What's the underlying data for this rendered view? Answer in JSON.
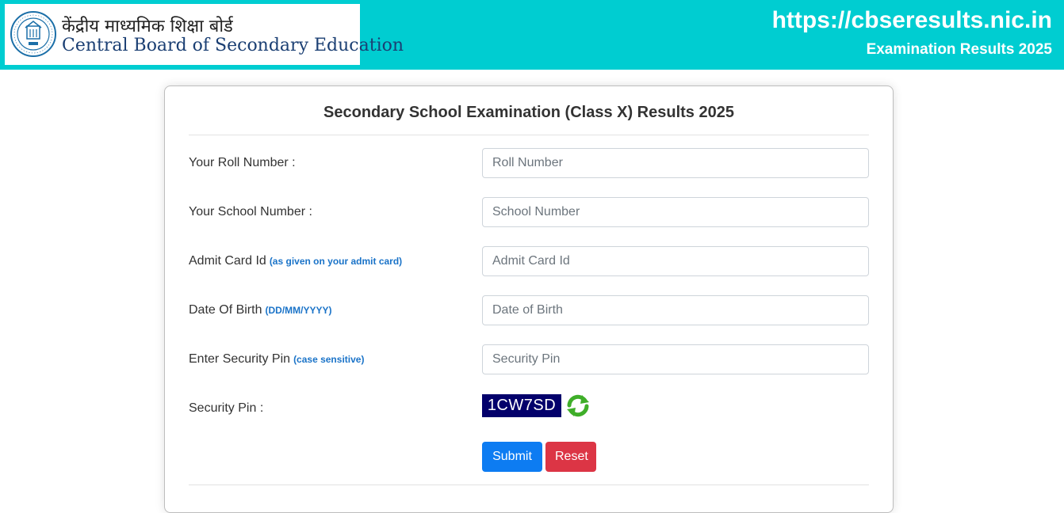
{
  "header": {
    "logo_hindi": "केंद्रीय माध्यमिक शिक्षा बोर्ड",
    "logo_english": "Central Board of Secondary Education",
    "site_url": "https://cbseresults.nic.in",
    "site_subtitle": "Examination Results 2025",
    "bg_color": "#00cdd1"
  },
  "form": {
    "title": "Secondary School Examination (Class X) Results 2025",
    "fields": [
      {
        "label": "Your Roll Number :",
        "note": "",
        "placeholder": "Roll Number",
        "value": ""
      },
      {
        "label": "Your School Number :",
        "note": "",
        "placeholder": "School Number",
        "value": ""
      },
      {
        "label": "Admit Card Id",
        "note": "(as given on your admit card)",
        "placeholder": "Admit Card Id",
        "value": ""
      },
      {
        "label": "Date Of Birth",
        "note": "(DD/MM/YYYY)",
        "placeholder": "Date of Birth",
        "value": ""
      },
      {
        "label": "Enter Security Pin",
        "note": "(case sensitive)",
        "placeholder": "Security Pin",
        "value": ""
      }
    ],
    "captcha": {
      "label": "Security Pin :",
      "code": "1CW7SD",
      "refresh_icon": "refresh-icon"
    },
    "buttons": {
      "submit": "Submit",
      "reset": "Reset"
    }
  },
  "colors": {
    "submit": "#0d7cf2",
    "reset": "#dc3545",
    "note": "#1a73c8",
    "captcha_bg": "#03006b"
  }
}
